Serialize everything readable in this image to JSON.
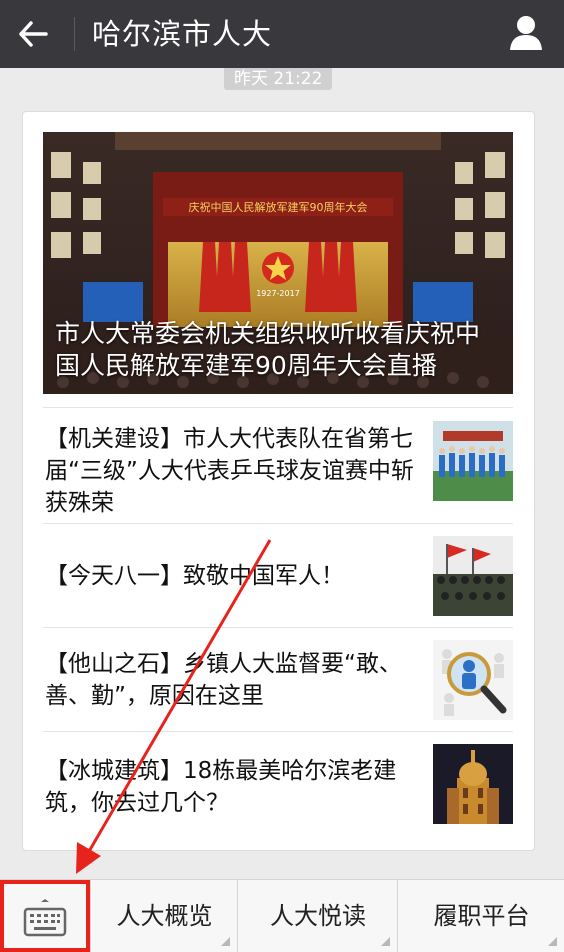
{
  "header": {
    "back_icon": "arrow-left-icon",
    "title": "哈尔滨市人大",
    "profile_icon": "person-icon"
  },
  "timestamp": "昨天 21:22",
  "hero": {
    "caption": "市人大常委会机关组织收听收看庆祝中国人民解放军建军90周年大会直播",
    "banner_text": "庆祝中国人民解放军建军90周年大会",
    "emblem_years": "1927-2017"
  },
  "articles": [
    {
      "title": "【机关建设】市人大代表队在省第七届“三级”人大代表乒乓球友谊赛中斩获殊荣"
    },
    {
      "title": "【今天八一】致敬中国军人！"
    },
    {
      "title": "【他山之石】乡镇人大监督要“敢、善、勤”，原因在这里"
    },
    {
      "title": "【冰城建筑】18栋最美哈尔滨老建筑，你去过几个？"
    }
  ],
  "menu": {
    "keyboard_icon": "keyboard-icon",
    "items": [
      "人大概览",
      "人大悦读",
      "履职平台"
    ]
  },
  "colors": {
    "header_bg": "#39393d",
    "highlight": "#e8231c",
    "background": "#ebebeb"
  }
}
